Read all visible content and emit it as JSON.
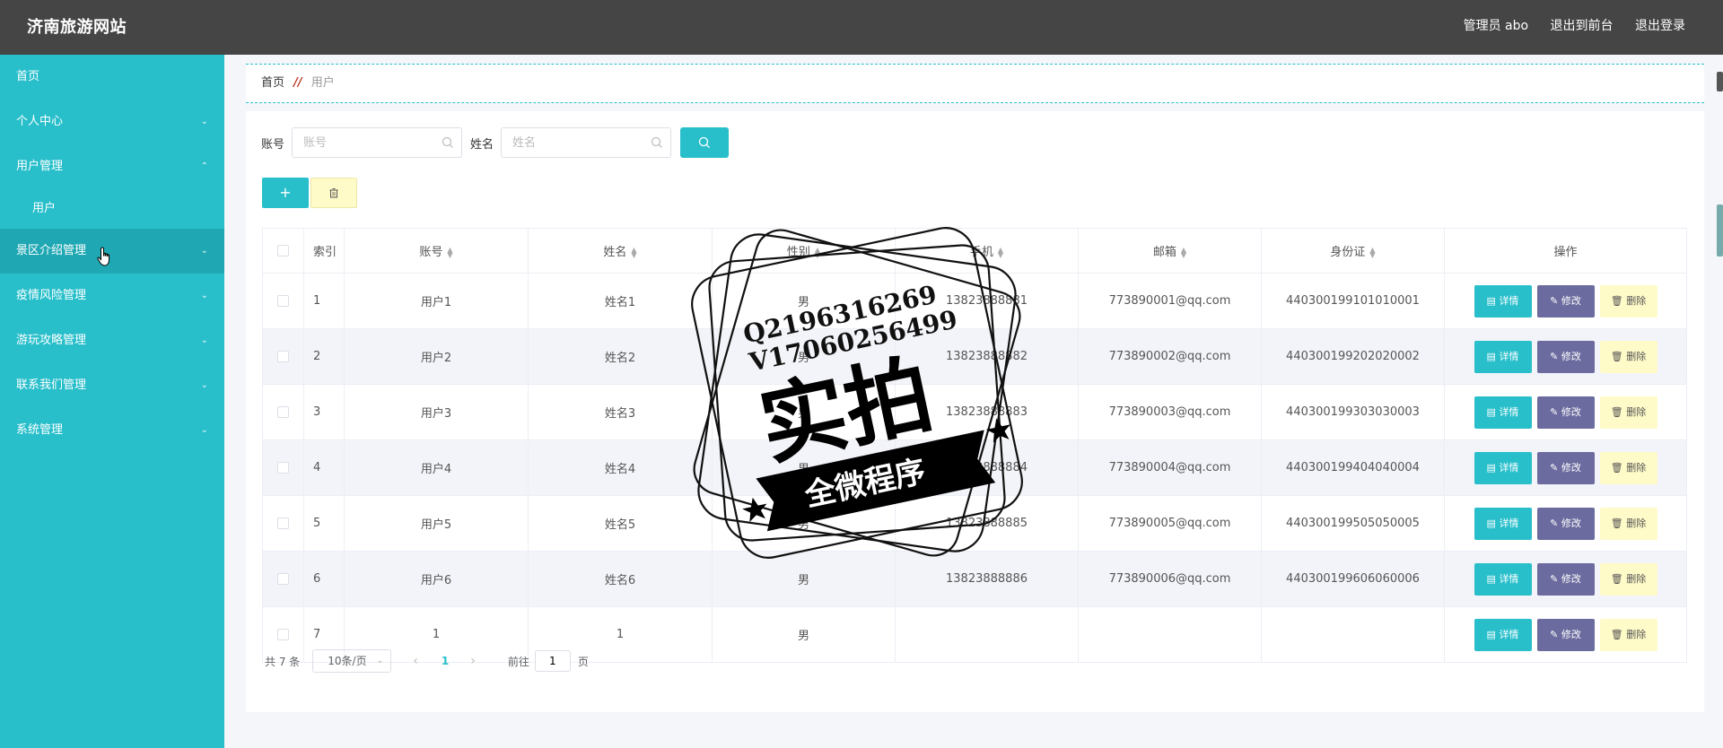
{
  "header": {
    "brand": "济南旅游网站",
    "admin_label": "管理员 abo",
    "back_front": "退出到前台",
    "logout": "退出登录"
  },
  "sidebar": {
    "items": [
      {
        "label": "首页",
        "chevron": ""
      },
      {
        "label": "个人中心",
        "chevron": "chevron-down"
      },
      {
        "label": "用户管理",
        "chevron": "chevron-up"
      },
      {
        "label": "用户",
        "chevron": ""
      },
      {
        "label": "景区介绍管理",
        "chevron": "chevron-down"
      },
      {
        "label": "疫情风险管理",
        "chevron": "chevron-down"
      },
      {
        "label": "游玩攻略管理",
        "chevron": "chevron-down"
      },
      {
        "label": "联系我们管理",
        "chevron": "chevron-down"
      },
      {
        "label": "系统管理",
        "chevron": "chevron-down"
      }
    ]
  },
  "breadcrumb": {
    "home": "首页",
    "separator": "//",
    "current": "用户"
  },
  "search": {
    "account_label": "账号",
    "account_placeholder": "账号",
    "name_label": "姓名",
    "name_placeholder": "姓名"
  },
  "actions": {
    "add_label": "+"
  },
  "table": {
    "headers": [
      "索引",
      "账号",
      "姓名",
      "性别",
      "手机",
      "邮箱",
      "身份证",
      "操作"
    ],
    "rows": [
      {
        "idx": "1",
        "account": "用户1",
        "name": "姓名1",
        "gender": "男",
        "phone": "13823888881",
        "email": "773890001@qq.com",
        "id": "440300199101010001"
      },
      {
        "idx": "2",
        "account": "用户2",
        "name": "姓名2",
        "gender": "男",
        "phone": "13823888882",
        "email": "773890002@qq.com",
        "id": "440300199202020002"
      },
      {
        "idx": "3",
        "account": "用户3",
        "name": "姓名3",
        "gender": "男",
        "phone": "13823888883",
        "email": "773890003@qq.com",
        "id": "440300199303030003"
      },
      {
        "idx": "4",
        "account": "用户4",
        "name": "姓名4",
        "gender": "男",
        "phone": "13823888884",
        "email": "773890004@qq.com",
        "id": "440300199404040004"
      },
      {
        "idx": "5",
        "account": "用户5",
        "name": "姓名5",
        "gender": "男",
        "phone": "13823888885",
        "email": "773890005@qq.com",
        "id": "440300199505050005"
      },
      {
        "idx": "6",
        "account": "用户6",
        "name": "姓名6",
        "gender": "男",
        "phone": "13823888886",
        "email": "773890006@qq.com",
        "id": "440300199606060006"
      },
      {
        "idx": "7",
        "account": "1",
        "name": "1",
        "gender": "男",
        "phone": "",
        "email": "",
        "id": ""
      }
    ],
    "op_detail": "详情",
    "op_edit": "修改",
    "op_delete": "删除"
  },
  "pagination": {
    "total": "共 7 条",
    "page_size": "10条/页",
    "current_page": "1",
    "goto_prefix": "前往",
    "goto_value": "1",
    "goto_suffix": "页"
  },
  "watermark": {
    "line1": "Q2196316269",
    "line2": "V17060256499",
    "big": "实拍",
    "banner": "全微程序"
  },
  "colors": {
    "accent": "#28bfcb",
    "topbar": "#454545",
    "edit": "#6b6b9f",
    "delete": "#fffbc8"
  }
}
